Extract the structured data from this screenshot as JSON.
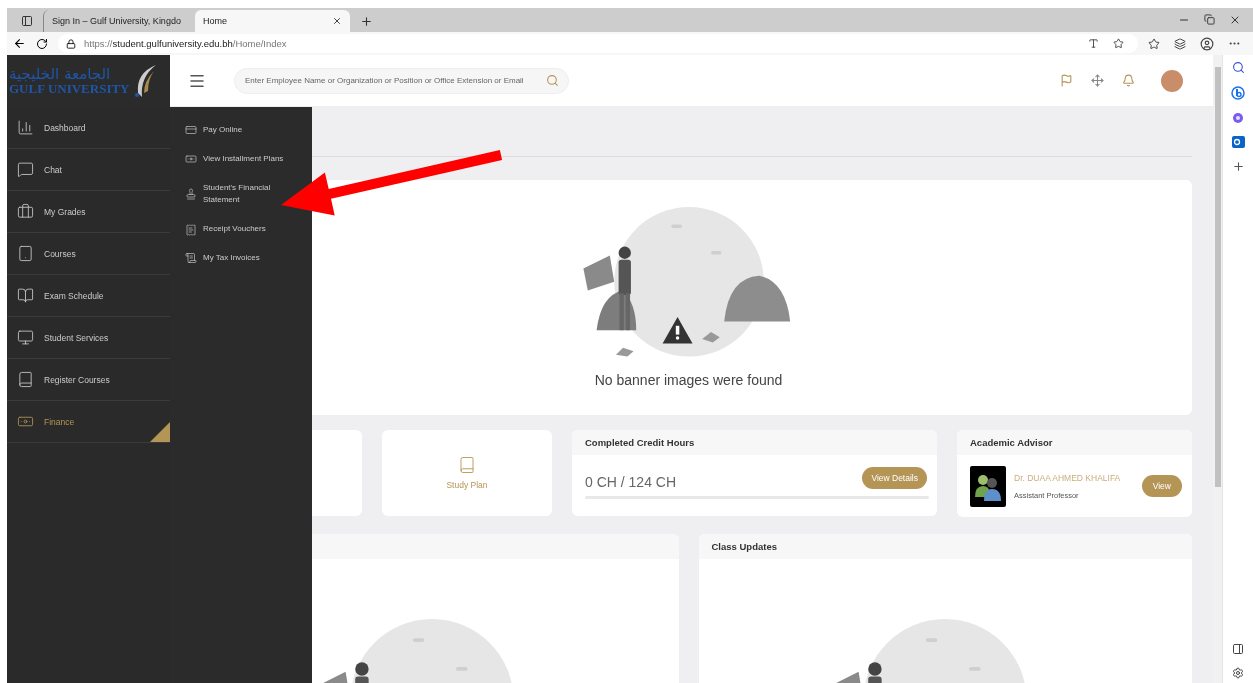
{
  "browser": {
    "tabs": [
      {
        "title": "Sign In – Gulf University, Kingdo",
        "selected": false
      },
      {
        "title": "Home",
        "selected": true
      }
    ],
    "url": {
      "scheme": "https://",
      "host": "student.gulfuniversity.edu.bh",
      "path": "/Home/Index"
    }
  },
  "logo": {
    "arabic": "الجامعة الخليجية",
    "english": "GULF UNIVERSITY"
  },
  "search": {
    "placeholder": "Enter Employee Name or Organization or Position or Office Extension or Email"
  },
  "sidebar": {
    "items": [
      {
        "label": "Dashboard",
        "selected": false
      },
      {
        "label": "Chat",
        "selected": false
      },
      {
        "label": "My Grades",
        "selected": false
      },
      {
        "label": "Courses",
        "selected": false
      },
      {
        "label": "Exam Schedule",
        "selected": false
      },
      {
        "label": "Student Services",
        "selected": false
      },
      {
        "label": "Register Courses",
        "selected": false
      },
      {
        "label": "Finance",
        "selected": true
      }
    ]
  },
  "submenu": {
    "items": [
      "Pay Online",
      "View Installment Plans",
      "Student's Financial Statement",
      "Receipt Vouchers",
      "My Tax Invoices"
    ]
  },
  "banner": {
    "message": "No banner images were found"
  },
  "study_plan": {
    "label": "Study Plan"
  },
  "credit_hours": {
    "title": "Completed Credit Hours",
    "value": "0 CH / 124 CH",
    "level": 0,
    "button": "View Details"
  },
  "advisor": {
    "title": "Academic Advisor",
    "name": "Dr. DUAA AHMED KHALIFA",
    "position": "Assistant Professor",
    "button": "View"
  },
  "class_updates": {
    "title": "Class Updates"
  }
}
